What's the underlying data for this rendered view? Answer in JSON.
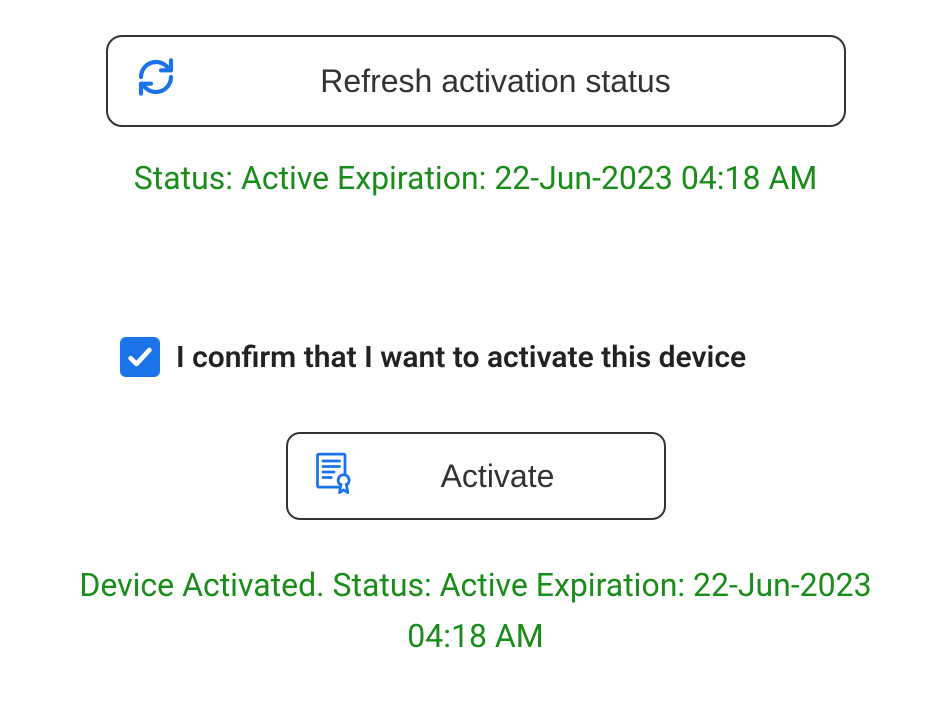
{
  "refresh": {
    "label": "Refresh activation status"
  },
  "status_line": "Status: Active Expiration: 22-Jun-2023 04:18 AM",
  "confirm": {
    "checked": true,
    "label": "I confirm that I want to activate this device"
  },
  "activate": {
    "label": "Activate"
  },
  "device_status_line": "Device Activated. Status: Active Expiration: 22-Jun-2023 04:18 AM",
  "colors": {
    "status_text": "#1a8c1a",
    "accent_blue": "#1a73e8",
    "border": "#333333"
  }
}
